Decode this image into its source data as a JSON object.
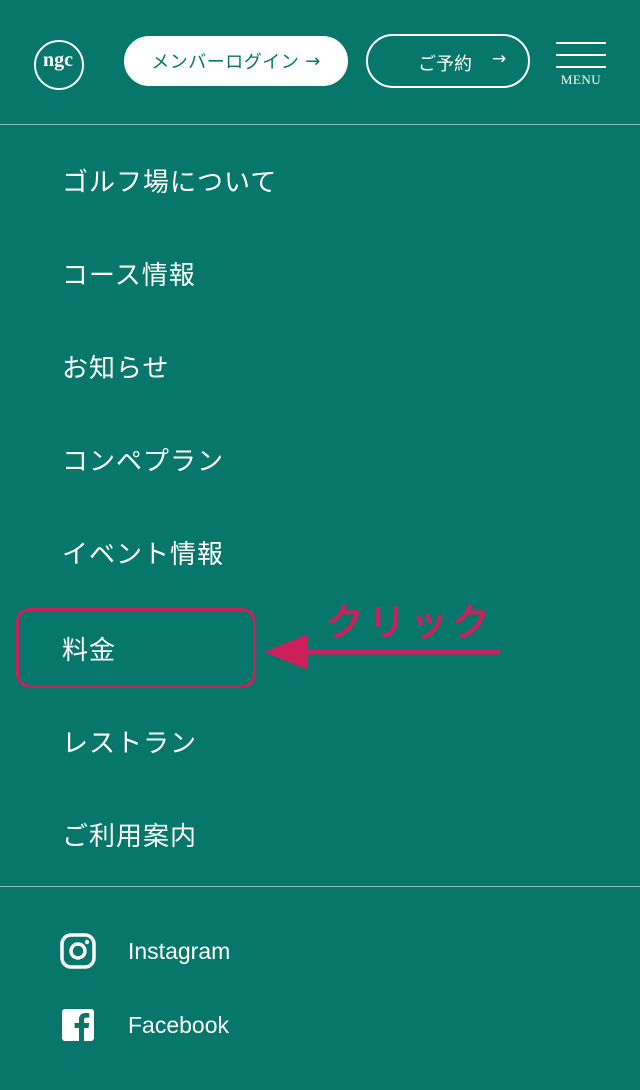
{
  "header": {
    "logo_text": "ngc",
    "member_login_label": "メンバーログイン",
    "member_login_arrow": "→",
    "reserve_label": "ご予約",
    "reserve_arrow": "→",
    "menu_label": "MENU"
  },
  "nav": {
    "items": [
      {
        "label": "ゴルフ場について"
      },
      {
        "label": "コース情報"
      },
      {
        "label": "お知らせ"
      },
      {
        "label": "コンペプラン"
      },
      {
        "label": "イベント情報"
      },
      {
        "label": "料金"
      },
      {
        "label": "レストラン"
      },
      {
        "label": "ご利用案内"
      }
    ]
  },
  "annotation": {
    "text": "クリック",
    "color": "#cc1f5c"
  },
  "social": {
    "instagram_label": "Instagram",
    "facebook_label": "Facebook"
  },
  "colors": {
    "background": "#06776a",
    "accent": "#cc1f5c",
    "text": "#ffffff"
  }
}
